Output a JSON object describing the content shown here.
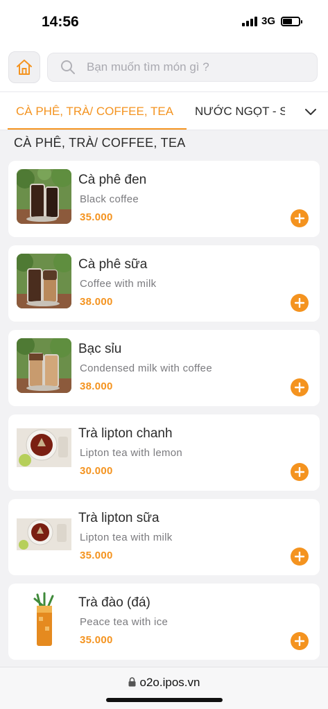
{
  "status_bar": {
    "time": "14:56",
    "network": "3G"
  },
  "header": {
    "home_icon": "home-icon",
    "search": {
      "placeholder": "Bạn muốn tìm món gì ?",
      "value": ""
    }
  },
  "tabs": {
    "items": [
      {
        "label": "CÀ PHÊ, TRÀ/ COFFEE, TEA",
        "active": true
      },
      {
        "label": "NƯỚC NGỌT - S",
        "active": false
      }
    ],
    "toggle_icon": "chevron-down-icon"
  },
  "section": {
    "title": "CÀ PHÊ, TRÀ/ COFFEE, TEA"
  },
  "menu": {
    "items": [
      {
        "name": "Cà phê đen",
        "description": "Black coffee",
        "price": "35.000",
        "image": "black-coffee-photo"
      },
      {
        "name": "Cà phê sữa",
        "description": "Coffee with milk",
        "price": "38.000",
        "image": "milk-coffee-photo"
      },
      {
        "name": "Bạc sỉu",
        "description": "Condensed milk with coffee",
        "price": "38.000",
        "image": "bac-siu-photo"
      },
      {
        "name": "Trà lipton chanh",
        "description": "Lipton tea with lemon",
        "price": "30.000",
        "image": "lemon-tea-photo"
      },
      {
        "name": "Trà lipton sữa",
        "description": "Lipton tea with milk",
        "price": "35.000",
        "image": "milk-tea-photo"
      },
      {
        "name": "Trà đào (đá)",
        "description": "Peace tea with ice",
        "price": "35.000",
        "image": "peach-tea-photo"
      }
    ]
  },
  "browser": {
    "url": "o2o.ipos.vn"
  },
  "colors": {
    "accent": "#f4931f",
    "card": "#ffffff",
    "background": "#f2f2f4"
  }
}
